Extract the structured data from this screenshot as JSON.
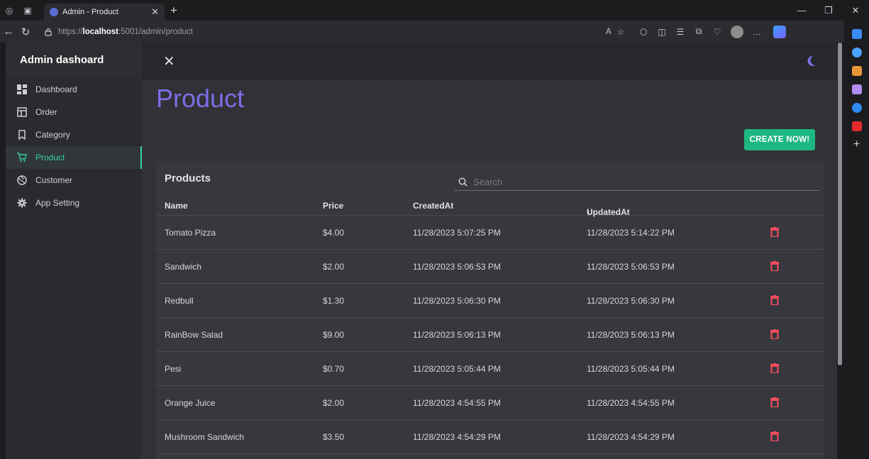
{
  "browser": {
    "tab_title": "Admin - Product",
    "url_prefix": "https://",
    "url_host": "localhost",
    "url_rest": ":5001/admin/product"
  },
  "sidebar": {
    "brand": "Admin dashoard",
    "items": [
      {
        "label": "Dashboard",
        "icon": "dashboard-icon"
      },
      {
        "label": "Order",
        "icon": "order-icon"
      },
      {
        "label": "Category",
        "icon": "bookmark-icon"
      },
      {
        "label": "Product",
        "icon": "cart-icon",
        "active": true
      },
      {
        "label": "Customer",
        "icon": "globe-icon"
      },
      {
        "label": "App Setting",
        "icon": "gear-icon"
      }
    ]
  },
  "page": {
    "title": "Product",
    "create_label": "CREATE NOW!"
  },
  "table": {
    "title": "Products",
    "search_placeholder": "Search",
    "columns": [
      "Name",
      "Price",
      "CreatedAt",
      "UpdatedAt"
    ],
    "sorted_column_arrow": "↓",
    "rows": [
      {
        "name": "Tomato Pizza",
        "price": "$4.00",
        "created": "11/28/2023 5:07:25 PM",
        "updated": "11/28/2023 5:14:22 PM"
      },
      {
        "name": "Sandwich",
        "price": "$2.00",
        "created": "11/28/2023 5:06:53 PM",
        "updated": "11/28/2023 5:06:53 PM"
      },
      {
        "name": "Redbull",
        "price": "$1.30",
        "created": "11/28/2023 5:06:30 PM",
        "updated": "11/28/2023 5:06:30 PM"
      },
      {
        "name": "RainBow Salad",
        "price": "$9.00",
        "created": "11/28/2023 5:06:13 PM",
        "updated": "11/28/2023 5:06:13 PM"
      },
      {
        "name": "Pesi",
        "price": "$0.70",
        "created": "11/28/2023 5:05:44 PM",
        "updated": "11/28/2023 5:05:44 PM"
      },
      {
        "name": "Orange Juice",
        "price": "$2.00",
        "created": "11/28/2023 4:54:55 PM",
        "updated": "11/28/2023 4:54:55 PM"
      },
      {
        "name": "Mushroom Sandwich",
        "price": "$3.50",
        "created": "11/28/2023 4:54:29 PM",
        "updated": "11/28/2023 4:54:29 PM"
      }
    ]
  },
  "colors": {
    "accent_title": "#7b6fe6",
    "active_nav": "#35d0a8",
    "create_button": "#1db780",
    "delete_icon": "#ff4d5e"
  }
}
